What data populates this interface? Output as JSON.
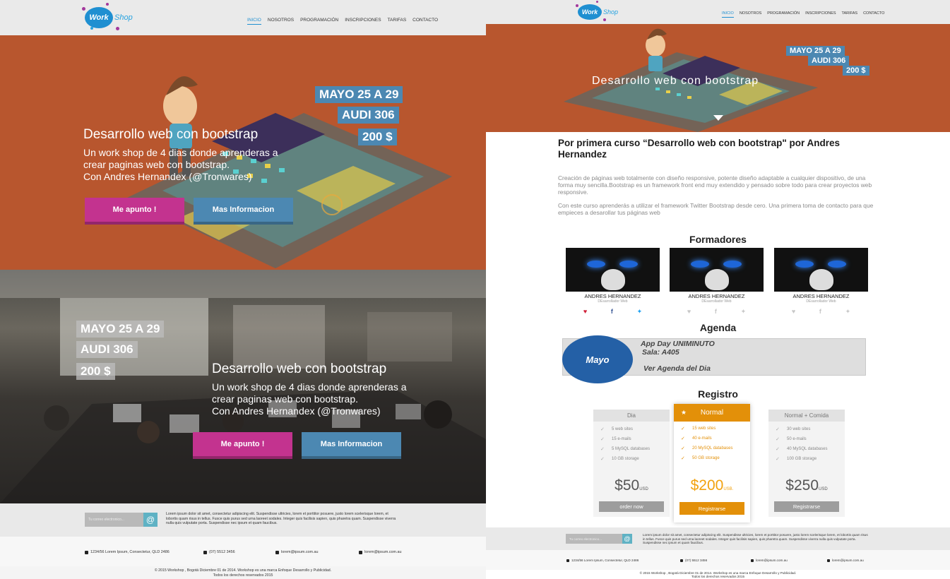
{
  "brand": {
    "logo_word": "Work",
    "logo_shop": "Shop"
  },
  "nav": [
    {
      "label": "INICIO",
      "active": true
    },
    {
      "label": "NOSOTROS"
    },
    {
      "label": "PROGRAMACIÓN"
    },
    {
      "label": "INSCRIPCIONES"
    },
    {
      "label": "TARIFAS"
    },
    {
      "label": "CONTACTO"
    }
  ],
  "hero1": {
    "date": "MAYO 25 A 29",
    "room": "AUDI 306",
    "price": "200 $",
    "title": "Desarrollo web con bootstrap",
    "desc": "Un work shop de 4 dias donde aprenderas a crear paginas web con bootstrap.\nCon Andres Hernandex (@Tronwares)",
    "btn_primary": "Me apunto !",
    "btn_secondary": "Mas Informacion"
  },
  "hero2": {
    "date": "MAYO 25 A 29",
    "room": "AUDI 306",
    "price": "200 $",
    "title": "Desarrollo web con bootstrap",
    "desc": "Un work shop de 4 dias donde aprenderas a crear paginas web con bootstrap.\nCon Andres Hernandex (@Tronwares)",
    "btn_primary": "Me apunto !",
    "btn_secondary": "Mas Informacion"
  },
  "right_hero": {
    "date": "MAYO 25 A 29",
    "room": "AUDI 306",
    "price": "200 $",
    "title": "Desarrollo web con bootstrap",
    "scroll_icon": "chevron-down-icon"
  },
  "intro": {
    "heading": "Por primera curso “Desarrollo web con bootstrap\" por Andres Hernandez",
    "p1": "Creación de páginas web totalmente con diseño responsive, potente diseño adaptable a cualquier dispositivo, de una forma muy sencilla.Bootstrap es un framework front end muy extendido y pensado sobre todo para crear proyectos web responsive.",
    "p2": "Con este curso aprenderás a utilizar el framework Twitter Bootstrap desde cero. Una primera toma de contacto para que empieces a desarollar tus páginas web"
  },
  "formadores": {
    "title": "Formadores",
    "people": [
      {
        "name": "ANDRES HERNANDEZ",
        "role": "DEsarrollador Web"
      },
      {
        "name": "ANDRES HERNANDEZ",
        "role": "DEsarrollador Web"
      },
      {
        "name": "ANDRES HERNANDEZ",
        "role": "DEsarrollador Web"
      }
    ],
    "social_icons": [
      "heart-icon",
      "facebook-icon",
      "twitter-icon"
    ],
    "colors": {
      "heart": "#d0213a",
      "facebook": "#3b5998",
      "twitter": "#1da1f2",
      "muted": "#c8c8c8"
    }
  },
  "agenda": {
    "title": "Agenda",
    "month": "Mayo",
    "line1": "App Day UNIMINUTO",
    "line2": "Sala: A405",
    "line3": "Ver Agenda del Dia"
  },
  "registro": {
    "title": "Registro",
    "plans": [
      {
        "name": "Dia",
        "features": [
          "5  web sites",
          "15 e-mails",
          "5  MySQL databases",
          "10 GB storage"
        ],
        "price": "$50",
        "unit": "USD",
        "button": "order now"
      },
      {
        "name": "Normal",
        "star": "★",
        "features": [
          "15 web sites",
          "40 e-mails",
          "20 MySQL databases",
          "50 GB storage"
        ],
        "price": "$200",
        "unit": "USB.",
        "button": "Registrarse"
      },
      {
        "name": "Normal + Comida",
        "features": [
          "30 web sites",
          "50 e-mails",
          "40 MySQL databases",
          "100 GB storage"
        ],
        "price": "$250",
        "unit": "USD",
        "button": "Registrarse"
      }
    ]
  },
  "newsletter": {
    "placeholder": "Tu correo electronico...",
    "icon": "at-icon",
    "text": "Lorem ipsum dolor sit amet, consectetur adipiscing elit. Suspendisse ultricies, lorem et porttitor posuere, justo lorem scelerisque lorem, et lobortis quam risus in tellus. Fusce quis purus sed urna laoreet sodales. Integer quis facilisis sapien, quis pharetra quam. Suspendisse viverra nulla quis vulputate porta. Suspendisse nec ipsum et quam faucibus."
  },
  "contact": {
    "address": "1234/56 Lorem Ipsum, Consectetur, QLD 2486",
    "phone": "(07) 5512 3456",
    "email1": "lorem@ipsum.com.au",
    "email2": "lorem@ipsum.com.au"
  },
  "footer": {
    "line1": "© 2015 Workshop , Bogotá Diciembre 01 de 2014. Workshop es una marca Enfoque Desarrollo y Publicidad.",
    "line2": "Todos los derechos reservados 2015"
  },
  "colors": {
    "orange": "#b8562e",
    "accent_blue": "#4c88b2",
    "pink": "#c3338f",
    "plan_orange": "#e39009",
    "nav_active": "#1f8fd1"
  }
}
